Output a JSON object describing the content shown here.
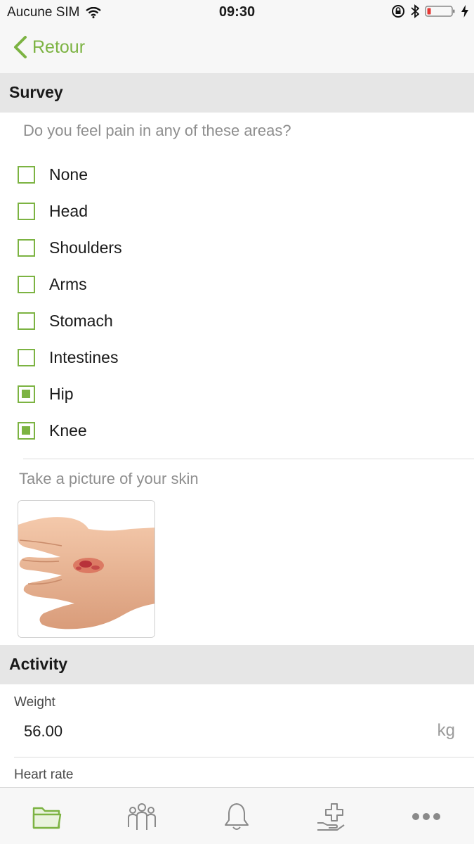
{
  "status_bar": {
    "carrier": "Aucune SIM",
    "time": "09:30"
  },
  "nav": {
    "back_label": "Retour"
  },
  "survey": {
    "title": "Survey",
    "question": "Do you feel pain in any of these areas?",
    "options": [
      {
        "label": "None",
        "checked": false
      },
      {
        "label": "Head",
        "checked": false
      },
      {
        "label": "Shoulders",
        "checked": false
      },
      {
        "label": "Arms",
        "checked": false
      },
      {
        "label": "Stomach",
        "checked": false
      },
      {
        "label": "Intestines",
        "checked": false
      },
      {
        "label": "Hip",
        "checked": true
      },
      {
        "label": "Knee",
        "checked": true
      }
    ],
    "picture_prompt": "Take a picture of your skin"
  },
  "activity": {
    "title": "Activity",
    "weight_label": "Weight",
    "weight_value": "56.00",
    "weight_unit": "kg",
    "heart_rate_label": "Heart rate"
  },
  "tab_bar": {
    "tabs": [
      {
        "icon": "folder-icon",
        "active": true
      },
      {
        "icon": "people-icon",
        "active": false
      },
      {
        "icon": "bell-icon",
        "active": false
      },
      {
        "icon": "medical-care-icon",
        "active": false
      },
      {
        "icon": "more-icon",
        "active": false
      }
    ]
  },
  "colors": {
    "accent": "#7cb342",
    "section_bg": "#e6e6e6",
    "muted_text": "#8e8e8e"
  }
}
